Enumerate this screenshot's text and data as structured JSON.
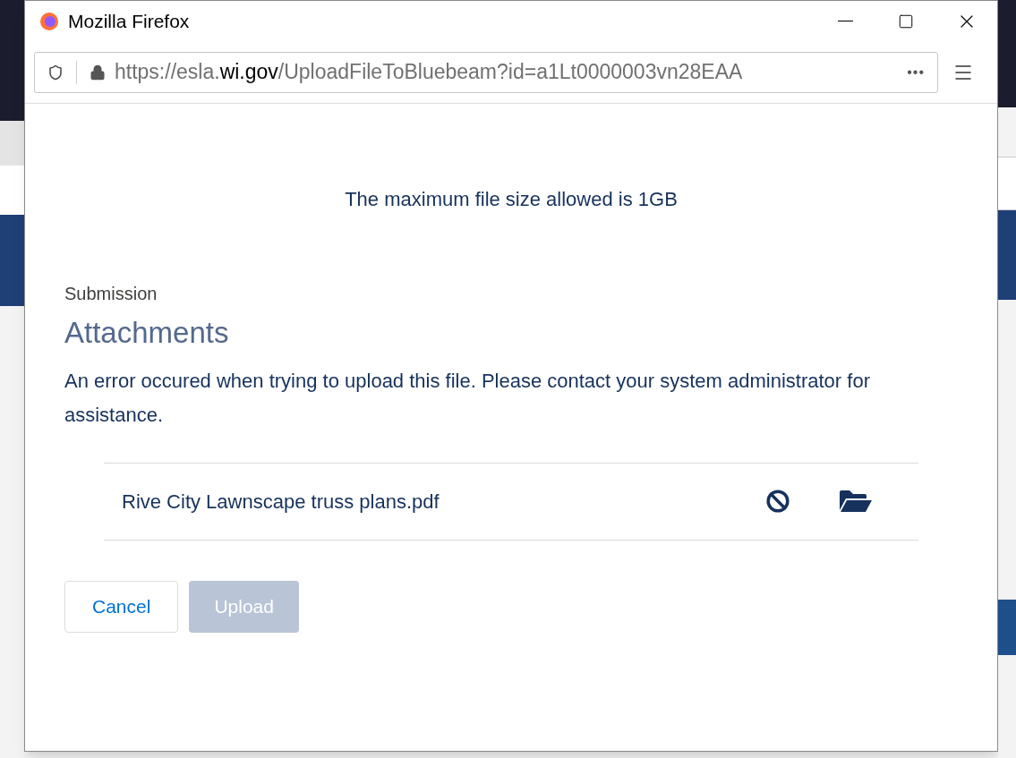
{
  "window": {
    "title": "Mozilla Firefox"
  },
  "address_bar": {
    "url_prefix": "https://esla.",
    "url_domain": "wi.gov",
    "url_path": "/UploadFileToBluebeam?id=a1Lt0000003vn28EAA",
    "more": "•••"
  },
  "notice": "The maximum file size allowed is 1GB",
  "section": {
    "label": "Submission",
    "heading": "Attachments"
  },
  "error": "An error occured when trying to upload this file. Please contact your system administrator for assistance.",
  "files": [
    {
      "name": "Rive City Lawnscape truss plans.pdf"
    }
  ],
  "buttons": [
    {
      "label": "Cancel",
      "disabled": false
    },
    {
      "label": "Upload",
      "disabled": true
    }
  ]
}
